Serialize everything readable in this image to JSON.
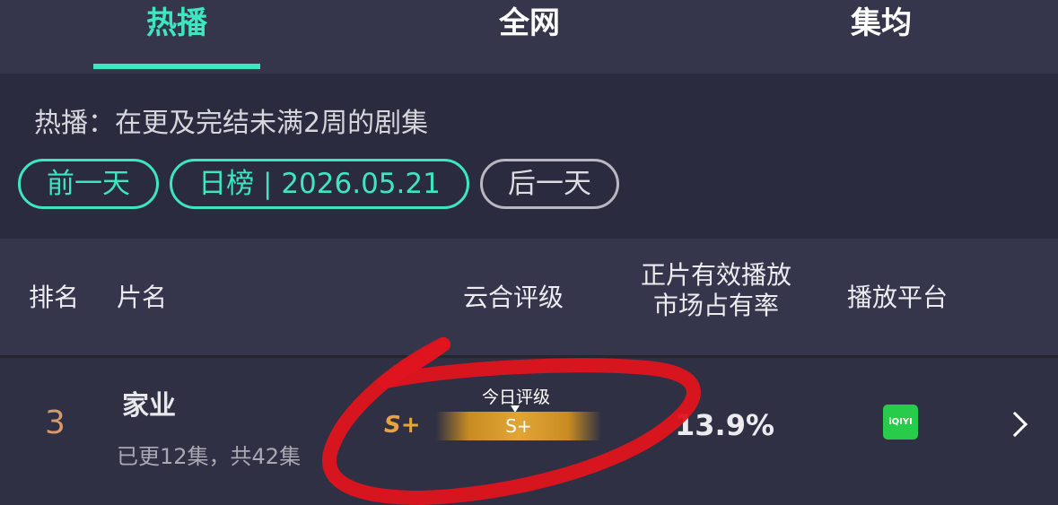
{
  "tabs": [
    {
      "label": "热播",
      "active": true
    },
    {
      "label": "全网",
      "active": false
    },
    {
      "label": "集均",
      "active": false
    }
  ],
  "filter": {
    "description": "热播：在更及完结未满2周的剧集",
    "prev_day": "前一天",
    "date_label": "日榜 | 2026.05.21",
    "next_day": "后一天"
  },
  "table_header": {
    "rank": "排名",
    "name": "片名",
    "grade": "云合评级",
    "share_line1": "正片有效播放",
    "share_line2": "市场占有率",
    "platform": "播放平台"
  },
  "rows": [
    {
      "rank": "3",
      "title": "家业",
      "episodes": "已更12集，共42集",
      "grade": "S+",
      "today_grade_label": "今日评级",
      "today_grade": "S+",
      "share": "13.9%",
      "platform": "iQIYI"
    }
  ],
  "colors": {
    "accent": "#3ee6bf",
    "grade_gold": "#e7a33c",
    "rank_orange": "#d89a6b",
    "platform_green": "#26cc4a",
    "annotation_red": "#e0141e"
  },
  "icons": {
    "platform": "iqiyi-logo",
    "row_arrow": "chevron-right-icon"
  }
}
